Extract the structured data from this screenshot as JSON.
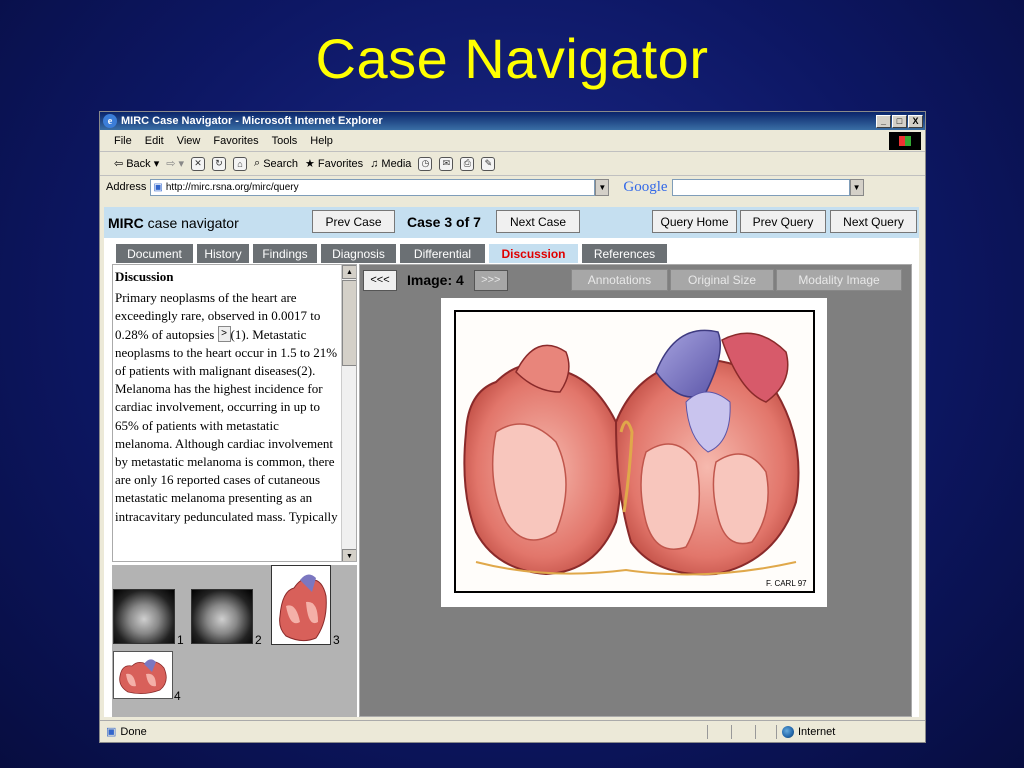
{
  "slide_title": "Case Navigator",
  "window": {
    "title": "MIRC Case Navigator - Microsoft Internet Explorer",
    "controls": [
      "_",
      "□",
      "X"
    ]
  },
  "menu": [
    "File",
    "Edit",
    "View",
    "Favorites",
    "Tools",
    "Help"
  ],
  "toolbar": {
    "back": "Back",
    "search": "Search",
    "favorites": "Favorites",
    "media": "Media"
  },
  "address": {
    "label": "Address",
    "url": "http://mirc.rsna.org/mirc/query",
    "search_engine": "Google"
  },
  "mirc": {
    "logo_bold": "MIRC",
    "logo_rest": " case navigator",
    "prev_case": "Prev Case",
    "case_counter": "Case 3 of 7",
    "next_case": "Next Case",
    "query_home": "Query Home",
    "prev_query": "Prev Query",
    "next_query": "Next Query"
  },
  "tabs": [
    {
      "label": "Document",
      "active": false
    },
    {
      "label": "History",
      "active": false
    },
    {
      "label": "Findings",
      "active": false
    },
    {
      "label": "Diagnosis",
      "active": false
    },
    {
      "label": "Differential",
      "active": false
    },
    {
      "label": "Discussion",
      "active": true
    },
    {
      "label": "References",
      "active": false
    }
  ],
  "discussion": {
    "heading": "Discussion",
    "text_a": "Primary neoplasms of the heart are exceedingly rare, observed in 0.0017 to 0.28% of autopsies ",
    "ref_button": ">",
    "text_b": "(1). Metastatic neoplasms to the heart occur in 1.5 to 21% of patients with malignant diseases(2). Melanoma has the highest incidence for cardiac involvement, occurring in up to 65% of patients with metastatic melanoma. Although cardiac involvement by metastatic melanoma is common, there are only 16 reported cases of cutaneous metastatic melanoma presenting as an intracavitary pedunculated mass. Typically"
  },
  "thumbnails": [
    {
      "number": "1",
      "kind": "ct"
    },
    {
      "number": "2",
      "kind": "ct"
    },
    {
      "number": "3",
      "kind": "heart"
    },
    {
      "number": "4",
      "kind": "heart"
    }
  ],
  "viewer": {
    "prev": "<<<",
    "image_label": "Image: 4",
    "next": ">>>",
    "annotations": "Annotations",
    "original_size": "Original Size",
    "modality_image": "Modality Image",
    "artist_signature": "F. CARL 97"
  },
  "status": {
    "text": "Done",
    "zone": "Internet"
  },
  "colors": {
    "slide_title": "#ffff00",
    "header_bg": "#c5dff0",
    "active_tab_text": "#e00000",
    "tab_bg": "#6b7074"
  }
}
